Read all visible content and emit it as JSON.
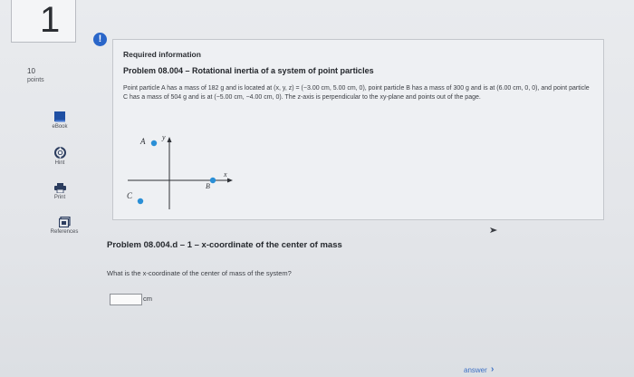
{
  "question": {
    "number": "1",
    "points_value": "10",
    "points_label": "points"
  },
  "tools": {
    "ebook": "eBook",
    "hint": "Hint",
    "print": "Print",
    "references": "References"
  },
  "info": {
    "heading": "Required information",
    "title": "Problem 08.004 – Rotational inertia of a system of point particles",
    "description": "Point particle A has a mass of 182 g and is located at (x, y, z) = (−3.00 cm, 5.00 cm, 0), point particle B has a mass of 300 g and is at (6.00 cm, 0, 0), and point particle C has a mass of 504 g and is at (−5.00 cm, −4.00 cm, 0). The z-axis is perpendicular to the xy-plane and points out of the page."
  },
  "diagram": {
    "label_a": "A",
    "label_b": "B",
    "label_c": "C",
    "axis_x": "x",
    "axis_y": "y",
    "point_color": "#2a8fd6"
  },
  "part_d": {
    "title": "Problem 08.004.d – 1 – x-coordinate of the center of mass",
    "question": "What is the x-coordinate of the center of mass of the system?",
    "answer_value": "",
    "unit": "cm"
  },
  "footer": {
    "link_text": "answer",
    "chevron": "›"
  },
  "colors": {
    "accent": "#2a66c9",
    "ebook_blue": "#1f4fa3"
  }
}
